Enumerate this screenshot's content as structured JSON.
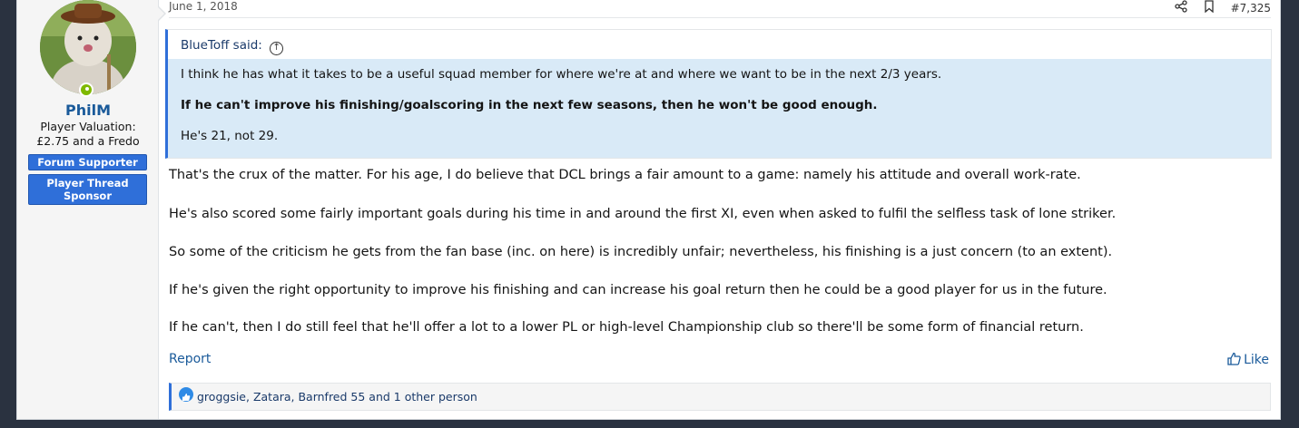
{
  "post": {
    "date": "June 1, 2018",
    "number": "#7,325",
    "icons": {
      "share": "share-icon",
      "bookmark": "bookmark-icon"
    }
  },
  "user": {
    "name": "PhilM",
    "title_line1": "Player Valuation:",
    "title_line2": "£2.75 and a Fredo",
    "banners": [
      "Forum Supporter",
      "Player Thread Sponsor"
    ]
  },
  "quote": {
    "author": "BlueToff said:",
    "lines": [
      "I think he has what it takes to be a useful squad member for where we're at and where we want to be in the next 2/3 years.",
      "If he can't improve his finishing/goalscoring in the next few seasons, then he won't be good enough.",
      "He's 21, not 29."
    ]
  },
  "message": [
    "That's the crux of the matter. For his age, I do believe that DCL brings a fair amount to a game: namely his attitude and overall work-rate.",
    "He's also scored some fairly important goals during his time in and around the first XI, even when asked to fulfil the selfless task of lone striker.",
    "So some of the criticism he gets from the fan base (inc. on here) is incredibly unfair; nevertheless, his finishing is a just concern (to an extent).",
    "If he's given the right opportunity to improve his finishing and can increase his goal return then he could be a good player for us in the future.",
    "If he can't, then I do still feel that he'll offer a lot to a lower PL or high-level Championship club so there'll be some form of financial return."
  ],
  "actions": {
    "report": "Report",
    "like": "Like"
  },
  "reactions": {
    "text": "groggsie, Zatara, Barnfred 55 and 1 other person"
  },
  "colors": {
    "accent": "#2f6fd9",
    "link": "#1a5a9a",
    "quote_bg": "#d9eaf7",
    "online": "#7fb900"
  }
}
